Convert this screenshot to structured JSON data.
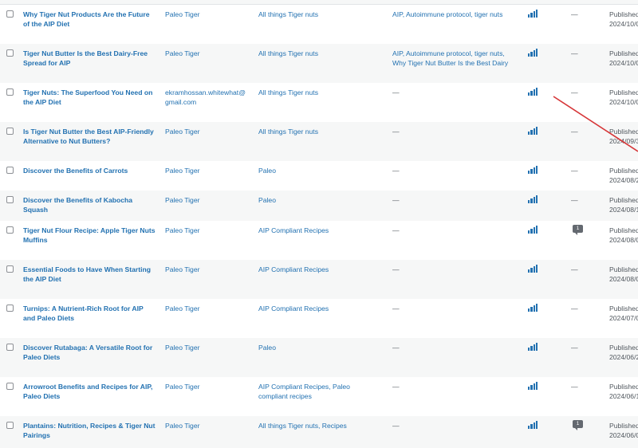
{
  "posts": [
    {
      "title": "Why Tiger Nut Products Are the Future of the AIP Diet",
      "author": "Paleo Tiger",
      "categories": "All things Tiger nuts",
      "tags": "AIP, Autoimmune protocol, tiger nuts",
      "comments": "—",
      "status": "Published",
      "date": "2024/10/0"
    },
    {
      "title": "Tiger Nut Butter Is the Best Dairy-Free Spread for AIP",
      "author": "Paleo Tiger",
      "categories": "All things Tiger nuts",
      "tags": "AIP, Autoimmune protocol, tiger nuts, Why Tiger Nut Butter Is the Best Dairy",
      "comments": "—",
      "status": "Published",
      "date": "2024/10/0"
    },
    {
      "title": "Tiger Nuts: The Superfood You Need on the AIP Diet",
      "author": "ekramhossan.whitewhat@gmail.com",
      "categories": "All things Tiger nuts",
      "tags": "—",
      "comments": "—",
      "status": "Published",
      "date": "2024/10/0"
    },
    {
      "title": "Is Tiger Nut Butter the Best AIP-Friendly Alternative to Nut Butters?",
      "author": "Paleo Tiger",
      "categories": "All things Tiger nuts",
      "tags": "—",
      "comments": "—",
      "status": "Published",
      "date": "2024/09/3"
    },
    {
      "title": "Discover the Benefits of Carrots",
      "author": "Paleo Tiger",
      "categories": "Paleo",
      "tags": "—",
      "comments": "—",
      "status": "Published",
      "date": "2024/08/2"
    },
    {
      "title": " Discover the Benefits of Kabocha Squash",
      "author": "Paleo Tiger",
      "categories": "Paleo",
      "tags": "—",
      "comments": "—",
      "status": "Published",
      "date": "2024/08/1"
    },
    {
      "title": "Tiger Nut Flour Recipe: Apple Tiger Nuts Muffins",
      "author": "Paleo Tiger",
      "categories": "AIP Compliant Recipes",
      "tags": "—",
      "comments": "1",
      "status": "Published",
      "date": "2024/08/0"
    },
    {
      "title": "Essential Foods to Have When Starting the AIP Diet",
      "author": "Paleo Tiger",
      "categories": "AIP Compliant Recipes",
      "tags": "—",
      "comments": "—",
      "status": "Published",
      "date": "2024/08/0"
    },
    {
      "title": "Turnips: A Nutrient-Rich Root for AIP and Paleo Diets",
      "author": "Paleo Tiger",
      "categories": "AIP Compliant Recipes",
      "tags": "—",
      "comments": "—",
      "status": "Published",
      "date": "2024/07/0"
    },
    {
      "title": "Discover Rutabaga: A Versatile Root for Paleo Diets",
      "author": "Paleo Tiger",
      "categories": "Paleo",
      "tags": "—",
      "comments": "—",
      "status": "Published",
      "date": "2024/06/2"
    },
    {
      "title": "Arrowroot Benefits and Recipes for AIP, Paleo Diets",
      "author": "Paleo Tiger",
      "categories": "AIP Compliant Recipes, Paleo compliant recipes",
      "tags": "—",
      "comments": "—",
      "status": "Published",
      "date": "2024/06/1"
    },
    {
      "title": "Plantains: Nutrition, Recipes & Tiger Nut Pairings",
      "author": "Paleo Tiger",
      "categories": "All things Tiger nuts, Recipes",
      "tags": "—",
      "comments": "1",
      "status": "Published",
      "date": "2024/06/0"
    }
  ],
  "colors": {
    "link": "#2271b1",
    "alt_row": "#f6f7f7",
    "annotation_arrow": "#d63638"
  },
  "icons": {
    "seo_score": "bar-chart-icon",
    "comment": "comment-bubble-icon"
  }
}
